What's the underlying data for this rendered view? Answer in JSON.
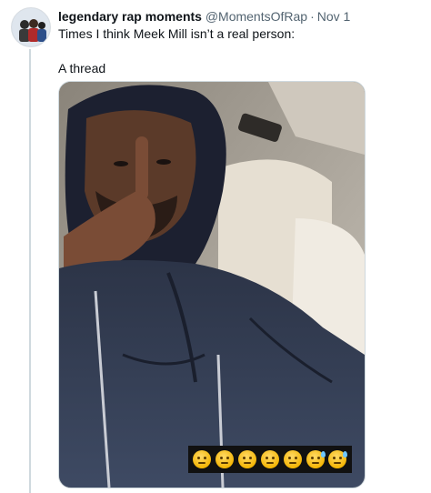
{
  "tweet": {
    "display_name": "legendary rap moments",
    "handle": "@MomentsOfRap",
    "separator": "·",
    "date": "Nov 1",
    "text_line1": "Times I think Meek Mill isn’t a real person:",
    "text_line2": "A thread"
  },
  "media": {
    "emoji_overlay": [
      "🤐",
      "🤐",
      "🤐",
      "🤐",
      "🤐",
      "😓",
      "😓"
    ]
  },
  "colors": {
    "text_primary": "#0f1419",
    "text_secondary": "#536471",
    "thread_line": "#cfd9de",
    "background": "#ffffff"
  }
}
